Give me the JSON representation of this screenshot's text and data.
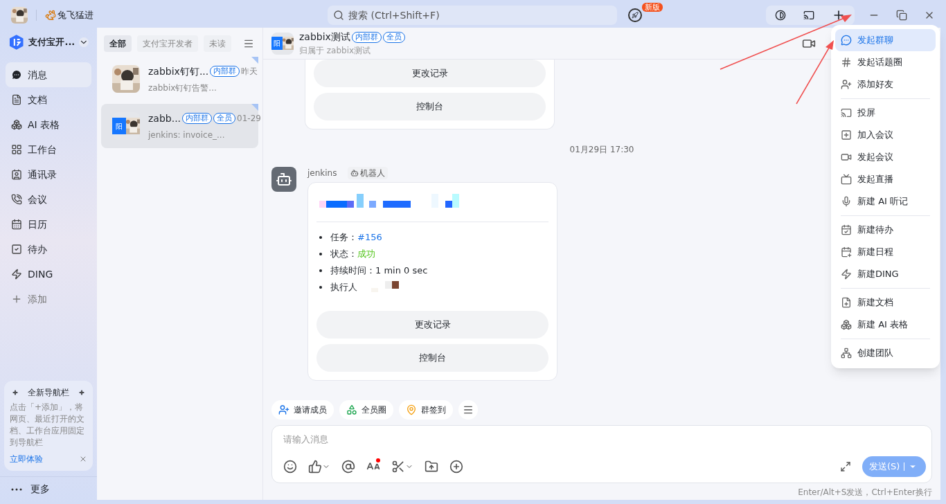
{
  "titlebar": {
    "status_text": "兔飞猛进",
    "search_placeholder": "搜索 (Ctrl+Shift+F)",
    "badge": "新版"
  },
  "org": {
    "name": "支付宝开..."
  },
  "nav": [
    {
      "label": "消息",
      "selected": true
    },
    {
      "label": "文档",
      "selected": false
    },
    {
      "label": "AI 表格",
      "selected": false
    },
    {
      "label": "工作台",
      "selected": false
    },
    {
      "label": "通讯录",
      "selected": false
    },
    {
      "label": "会议",
      "selected": false
    },
    {
      "label": "日历",
      "selected": false
    },
    {
      "label": "待办",
      "selected": false
    },
    {
      "label": "DING",
      "selected": false
    }
  ],
  "nav_add": "添加",
  "promo": {
    "title": "全新导航栏",
    "text": "点击「+添加」，将网页、最近打开的文档、工作台应用固定到导航栏",
    "link": "立即体验"
  },
  "more": "更多",
  "filters": [
    {
      "label": "全部",
      "selected": true
    },
    {
      "label": "支付宝开发者",
      "selected": false
    },
    {
      "label": "未读",
      "selected": false
    }
  ],
  "conversations": [
    {
      "name": "zabbix钉钉...",
      "tags": [
        "内部群"
      ],
      "time": "昨天",
      "preview": "zabbix钉钉告警...",
      "selected": false
    },
    {
      "name": "zabb...",
      "tags": [
        "内部群",
        "全员"
      ],
      "time": "01-29",
      "preview": "jenkins: invoice_...",
      "selected": true,
      "avatar_text": "阳"
    }
  ],
  "chat": {
    "title": "zabbix测试",
    "tags": [
      "内部群",
      "全员"
    ],
    "subtitle": "归属于 zabbix测试",
    "avatar_text": "阳",
    "messages": [
      {
        "kind": "card_tail",
        "buttons": [
          "更改记录",
          "控制台"
        ]
      },
      {
        "kind": "time",
        "text": "01月29日 17:30"
      },
      {
        "kind": "bot_card",
        "sender": "jenkins",
        "badge": "机器人",
        "fields": [
          {
            "label": "任务：",
            "value": "#156",
            "kind": "link"
          },
          {
            "label": "状态：",
            "value": "成功",
            "kind": "success"
          },
          {
            "label": "持续时间：",
            "value": "1 min 0 sec",
            "kind": "plain"
          },
          {
            "label": "执行人",
            "kind": "redacted"
          }
        ],
        "buttons": [
          "更改记录",
          "控制台"
        ]
      }
    ]
  },
  "quick_actions": [
    {
      "label": "邀请成员"
    },
    {
      "label": "全员圈"
    },
    {
      "label": "群签到"
    }
  ],
  "input": {
    "placeholder": "请输入消息",
    "send": "发送(S)",
    "hint": "Enter/Alt+S发送，Ctrl+Enter换行"
  },
  "menu": [
    [
      {
        "label": "发起群聊",
        "selected": true
      },
      {
        "label": "发起话题圈",
        "selected": false
      },
      {
        "label": "添加好友",
        "selected": false
      }
    ],
    [
      {
        "label": "投屏",
        "selected": false
      },
      {
        "label": "加入会议",
        "selected": false
      },
      {
        "label": "发起会议",
        "selected": false
      },
      {
        "label": "发起直播",
        "selected": false
      },
      {
        "label": "新建 AI 听记",
        "selected": false
      }
    ],
    [
      {
        "label": "新建待办",
        "selected": false
      },
      {
        "label": "新建日程",
        "selected": false
      },
      {
        "label": "新建DING",
        "selected": false
      }
    ],
    [
      {
        "label": "新建文档",
        "selected": false
      },
      {
        "label": "新建 AI 表格",
        "selected": false
      }
    ],
    [
      {
        "label": "创建团队",
        "selected": false
      }
    ]
  ]
}
